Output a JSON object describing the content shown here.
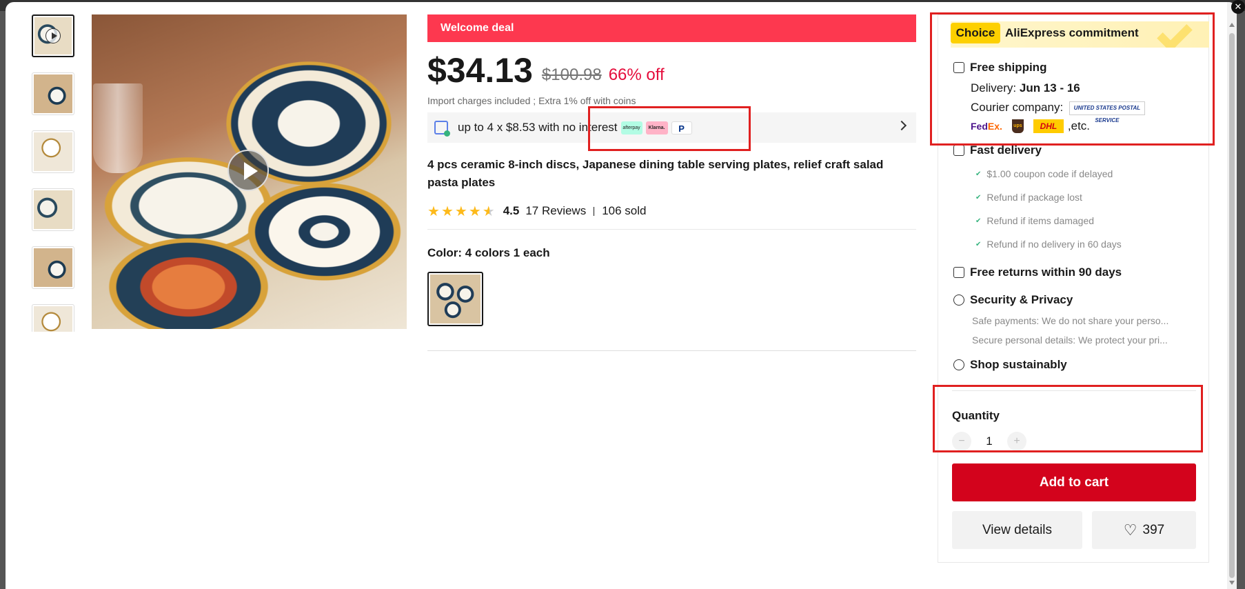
{
  "modal": {
    "close_label": "✕"
  },
  "gallery": {
    "thumb_count": 6
  },
  "deal": {
    "banner": "Welcome deal"
  },
  "price": {
    "current": "$34.13",
    "original": "$100.98",
    "discount": "66% off",
    "import_note": "Import charges included ; Extra 1% off with coins"
  },
  "installment": {
    "text": "up to 4 x $8.53 with no interest",
    "afterpay": "afterpay",
    "klarna": "Klarna.",
    "paypal": "P"
  },
  "product": {
    "title": "4 pcs ceramic 8-inch discs, Japanese dining table serving plates, relief craft salad pasta plates",
    "rating": "4.5",
    "reviews": "17 Reviews",
    "sold": "106 sold",
    "stars": 4.5
  },
  "color": {
    "label": "Color: 4 colors 1 each"
  },
  "commitment": {
    "choice_badge": "Choice",
    "title": "AliExpress commitment",
    "free_shipping": "Free shipping",
    "delivery_label": "Delivery: ",
    "delivery_dates": "Jun 13 - 16",
    "courier_label": "Courier company:",
    "usps": "UNITED STATES POSTAL SERVICE",
    "fedex_a": "Fed",
    "fedex_b": "Ex.",
    "ups": "ups",
    "dhl": "DHL",
    "etc": ",etc.",
    "fast_delivery": "Fast delivery",
    "fast_items": [
      "$1.00 coupon code if delayed",
      "Refund if package lost",
      "Refund if items damaged",
      "Refund if no delivery in 60 days"
    ],
    "free_returns": "Free returns within 90 days",
    "security": "Security & Privacy",
    "security_items": [
      "Safe payments: We do not share your perso...",
      "Secure personal details: We protect your pri..."
    ],
    "sustain": "Shop sustainably"
  },
  "quantity": {
    "label": "Quantity",
    "value": "1",
    "minus": "−",
    "plus": "+"
  },
  "actions": {
    "add_to_cart": "Add to cart",
    "view_details": "View details",
    "wishlist_count": "397"
  }
}
